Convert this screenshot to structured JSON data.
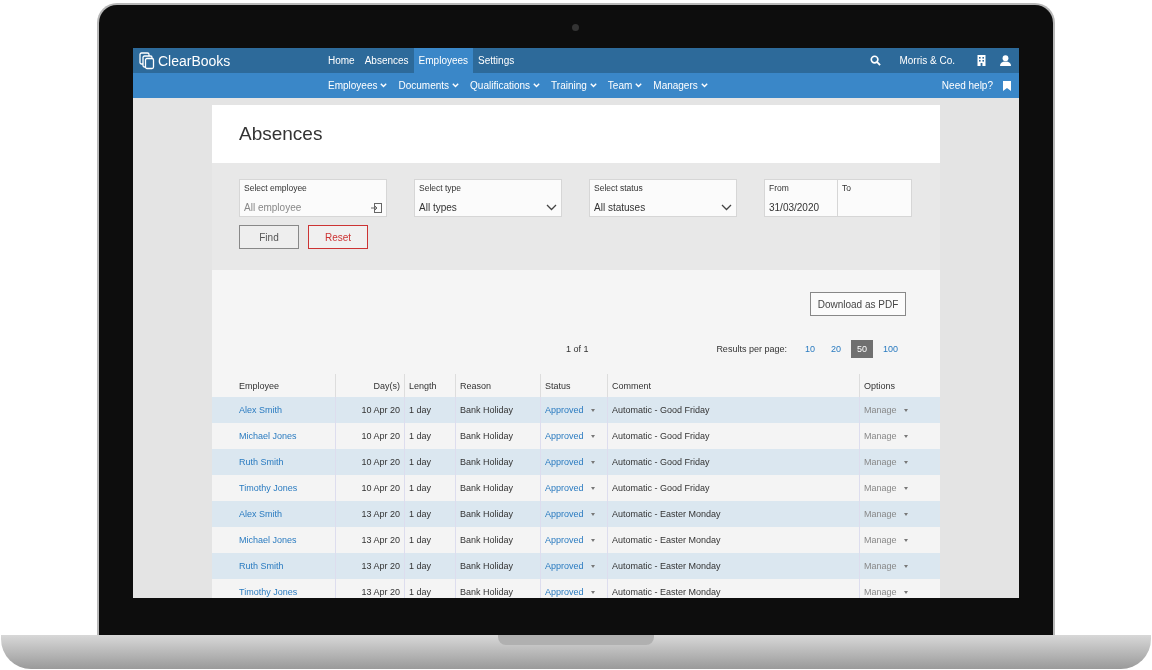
{
  "brand": "ClearBooks",
  "nav": {
    "tabs": [
      {
        "label": "Home",
        "selected": false
      },
      {
        "label": "Absences",
        "selected": false
      },
      {
        "label": "Employees",
        "selected": true
      },
      {
        "label": "Settings",
        "selected": false
      }
    ],
    "company": "Morris & Co."
  },
  "subnav": {
    "items": [
      "Employees",
      "Documents",
      "Qualifications",
      "Training",
      "Team",
      "Managers"
    ],
    "help": "Need help?"
  },
  "page_title": "Absences",
  "filters": {
    "employee": {
      "label": "Select employee",
      "placeholder": "All employee"
    },
    "type": {
      "label": "Select type",
      "value": "All types"
    },
    "status": {
      "label": "Select status",
      "value": "All statuses"
    },
    "from": {
      "label": "From",
      "value": "31/03/2020"
    },
    "to": {
      "label": "To"
    },
    "find": "Find",
    "reset": "Reset"
  },
  "download": "Download as PDF",
  "pagination": "1 of 1",
  "per_page": {
    "label": "Results per page:",
    "options": [
      {
        "label": "10",
        "selected": false
      },
      {
        "label": "20",
        "selected": false
      },
      {
        "label": "50",
        "selected": true
      },
      {
        "label": "100",
        "selected": false
      }
    ]
  },
  "table": {
    "columns": [
      "Employee",
      "Day(s)",
      "Length",
      "Reason",
      "Status",
      "Comment",
      "Options"
    ],
    "rows": [
      {
        "employee": "Alex Smith",
        "days": "10 Apr 20",
        "length": "1 day",
        "reason": "Bank Holiday",
        "status": "Approved",
        "comment": "Automatic - Good Friday",
        "options": "Manage"
      },
      {
        "employee": "Michael Jones",
        "days": "10 Apr 20",
        "length": "1 day",
        "reason": "Bank Holiday",
        "status": "Approved",
        "comment": "Automatic - Good Friday",
        "options": "Manage"
      },
      {
        "employee": "Ruth Smith",
        "days": "10 Apr 20",
        "length": "1 day",
        "reason": "Bank Holiday",
        "status": "Approved",
        "comment": "Automatic - Good Friday",
        "options": "Manage"
      },
      {
        "employee": "Timothy Jones",
        "days": "10 Apr 20",
        "length": "1 day",
        "reason": "Bank Holiday",
        "status": "Approved",
        "comment": "Automatic - Good Friday",
        "options": "Manage"
      },
      {
        "employee": "Alex Smith",
        "days": "13 Apr 20",
        "length": "1 day",
        "reason": "Bank Holiday",
        "status": "Approved",
        "comment": "Automatic - Easter Monday",
        "options": "Manage"
      },
      {
        "employee": "Michael Jones",
        "days": "13 Apr 20",
        "length": "1 day",
        "reason": "Bank Holiday",
        "status": "Approved",
        "comment": "Automatic - Easter Monday",
        "options": "Manage"
      },
      {
        "employee": "Ruth Smith",
        "days": "13 Apr 20",
        "length": "1 day",
        "reason": "Bank Holiday",
        "status": "Approved",
        "comment": "Automatic - Easter Monday",
        "options": "Manage"
      },
      {
        "employee": "Timothy Jones",
        "days": "13 Apr 20",
        "length": "1 day",
        "reason": "Bank Holiday",
        "status": "Approved",
        "comment": "Automatic - Easter Monday",
        "options": "Manage"
      }
    ]
  }
}
